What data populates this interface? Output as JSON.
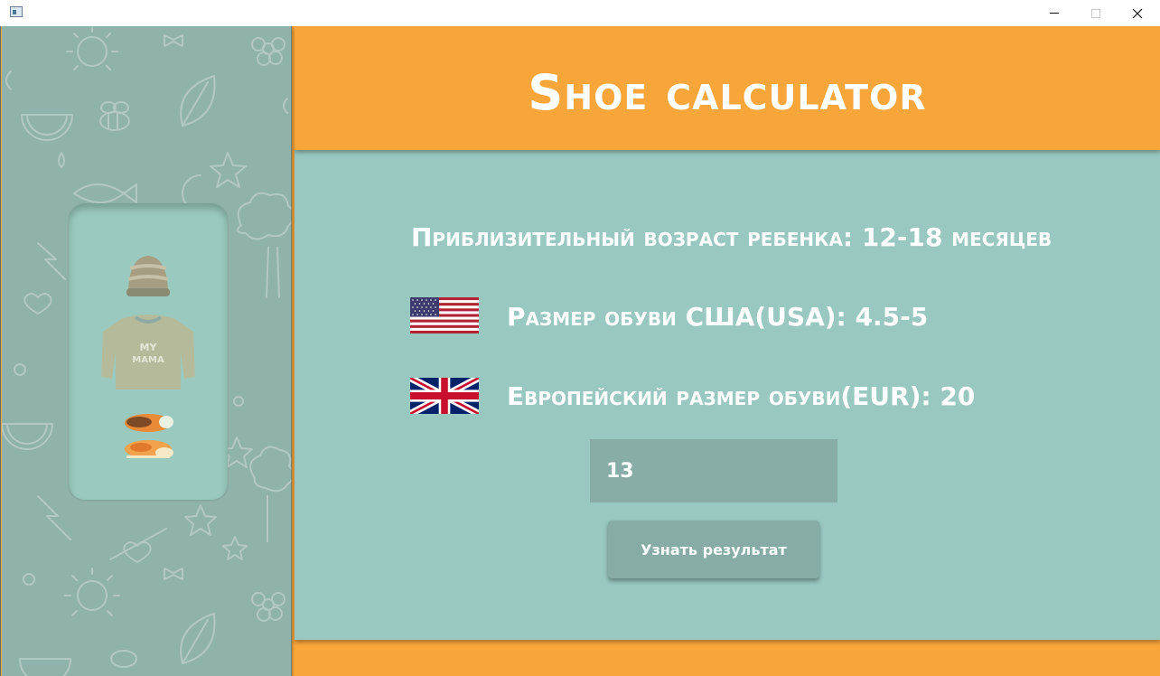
{
  "window": {
    "title": "",
    "controls": {
      "minimize": "minimize-icon",
      "maximize": "maximize-icon",
      "close": "close-icon"
    },
    "close_glyph": "✕"
  },
  "header": {
    "title": "Shoe calculator"
  },
  "results": {
    "age_line": "Приблизительный возраст ребенка: 12-18 месяцев",
    "usa_line": "Размер обуви США(USA): 4.5-5",
    "eur_line": "Европейский размер обуви(EUR): 20"
  },
  "flags": {
    "usa": "us-flag-icon",
    "uk": "uk-flag-icon"
  },
  "input": {
    "value": "13"
  },
  "button": {
    "label": "Узнать результат"
  },
  "colors": {
    "accent_orange": "#f8a53a",
    "panel_teal": "#98c8bf",
    "sidebar": "#8fb2ab",
    "input_bg": "#88aca6",
    "button_bg": "#87aca5",
    "text": "#ffffff"
  }
}
